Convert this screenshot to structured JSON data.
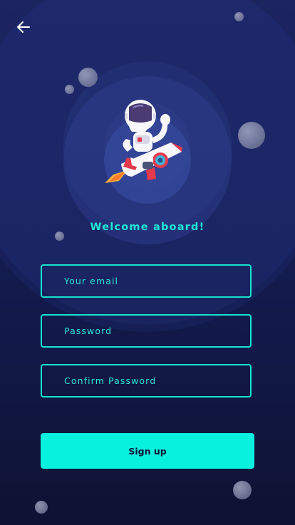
{
  "header": {
    "back_icon": "arrow-left-icon"
  },
  "hero": {
    "illustration": "astronaut-rocket-icon"
  },
  "welcome_text": "Welcome aboard!",
  "form": {
    "email_placeholder": "Your email",
    "password_placeholder": "Password",
    "confirm_password_placeholder": "Confirm Password"
  },
  "signup_label": "Sign up",
  "colors": {
    "accent": "#08f1df",
    "background": "#121a4a"
  }
}
